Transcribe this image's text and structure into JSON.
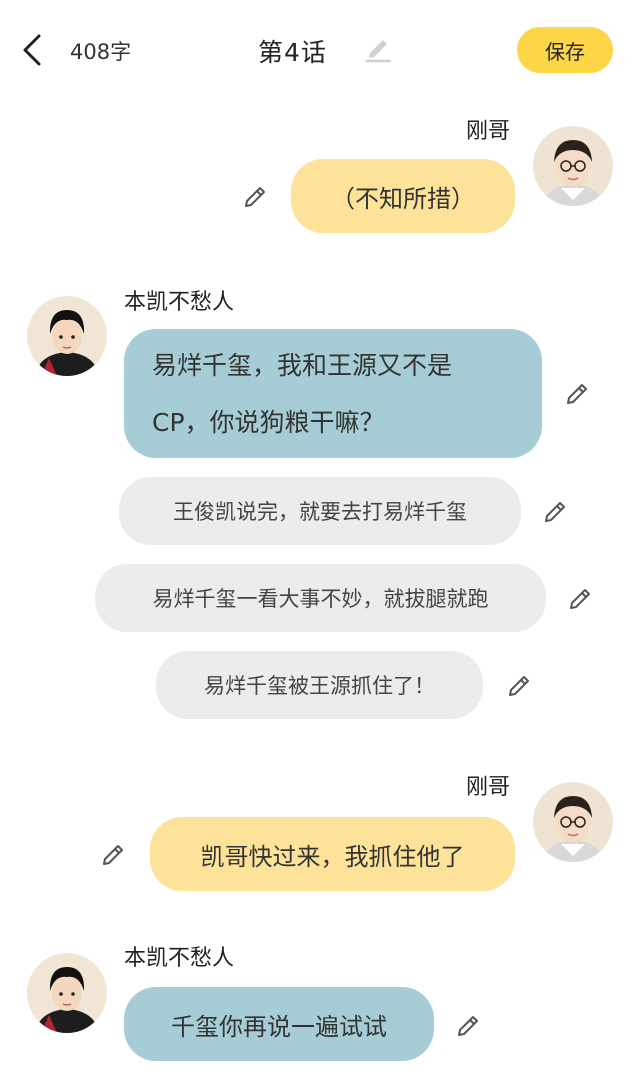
{
  "header": {
    "word_count": "408字",
    "chapter_title": "第4话",
    "save_label": "保存"
  },
  "messages": [
    {
      "speaker": "刚哥",
      "side": "right",
      "style": "yellow",
      "lines": [
        "（不知所措）"
      ]
    },
    {
      "speaker": "本凯不愁人",
      "side": "left",
      "style": "blue",
      "lines": [
        "易烊千玺，我和王源又不是",
        "CP，你说狗粮干嘛？"
      ]
    },
    {
      "side": "narration",
      "style": "grey",
      "lines": [
        "王俊凯说完，就要去打易烊千玺"
      ]
    },
    {
      "side": "narration",
      "style": "grey",
      "lines": [
        "易烊千玺一看大事不妙，就拔腿就跑"
      ]
    },
    {
      "side": "narration",
      "style": "grey",
      "lines": [
        "易烊千玺被王源抓住了！"
      ]
    },
    {
      "speaker": "刚哥",
      "side": "right",
      "style": "yellow",
      "lines": [
        "凯哥快过来，我抓住他了"
      ]
    },
    {
      "speaker": "本凯不愁人",
      "side": "left",
      "style": "blue",
      "lines": [
        "千玺你再说一遍试试"
      ]
    }
  ],
  "icons": {
    "back": "chevron-left-icon",
    "edit": "pencil-icon",
    "avatar_right": "boy-with-glasses-avatar",
    "avatar_left": "boy-dark-hair-avatar"
  },
  "colors": {
    "save_button": "#fdd648",
    "yellow_bubble": "#fde39a",
    "blue_bubble": "#a6cdd6",
    "grey_bubble": "#ececec"
  }
}
